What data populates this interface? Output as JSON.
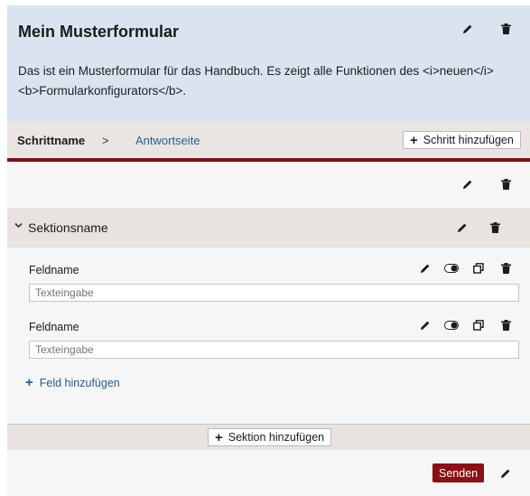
{
  "form": {
    "title": "Mein Musterformular",
    "description": "Das ist ein Musterformular für das Handbuch. Es zeigt alle Funktionen des <i>neuen</i> <b>Formularkonfigurators</b>."
  },
  "steps": {
    "current": "Schrittname",
    "separator": ">",
    "next": "Antwortseite",
    "add_label": "Schritt hinzufügen"
  },
  "section": {
    "title": "Sektionsname",
    "fields": [
      {
        "label": "Feldname",
        "placeholder": "Texteingabe"
      },
      {
        "label": "Feldname",
        "placeholder": "Texteingabe"
      }
    ],
    "add_field_label": "Feld hinzufügen"
  },
  "add_section_label": "Sektion hinzufügen",
  "send_label": "Senden",
  "colors": {
    "header_bg": "#d9e4f0",
    "accent_red": "#8b0f14",
    "link_blue": "#2a5d8f"
  },
  "icons": [
    "pencil-icon",
    "trash-icon",
    "toggle-icon",
    "copy-icon",
    "plus-icon",
    "chevron-down-icon"
  ]
}
